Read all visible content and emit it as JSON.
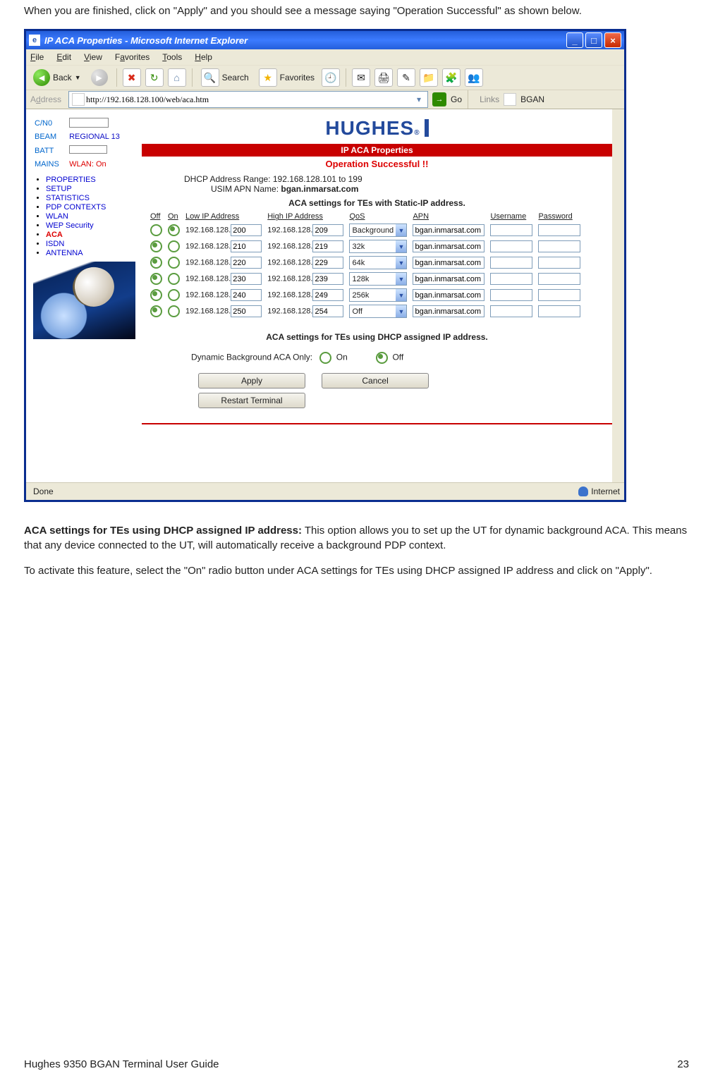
{
  "doc": {
    "intro_text": "When you are finished, click on \"Apply\" and you should see a message saying \"Operation Successful\" as shown below.",
    "after_title": "ACA settings for TEs using DHCP assigned IP address:",
    "after_body1": "  This option allows you to set up the UT for dynamic background ACA.  This means that any device connected to the UT, will automatically receive a background PDP context.",
    "after_body2": "To activate this feature, select the \"On\" radio button under ACA settings for TEs using DHCP assigned IP address and click on \"Apply\".",
    "footer_left": "Hughes 9350 BGAN Terminal User Guide",
    "footer_right": "23"
  },
  "window": {
    "title": "IP ACA Properties - Microsoft Internet Explorer",
    "menu": {
      "file": "File",
      "edit": "Edit",
      "view": "View",
      "favorites": "Favorites",
      "tools": "Tools",
      "help": "Help"
    },
    "toolbar": {
      "back": "Back",
      "search": "Search",
      "favorites": "Favorites"
    },
    "address_label": "Address",
    "url": "http://192.168.128.100/web/aca.htm",
    "go": "Go",
    "links_label": "Links",
    "link1": "BGAN",
    "status_left": "Done",
    "status_right": "Internet"
  },
  "sidebar": {
    "cn0": "C/N0",
    "beam_label": "BEAM",
    "beam_value": "REGIONAL 13",
    "batt": "BATT",
    "mains": "MAINS",
    "wlan": "WLAN: On",
    "nav": [
      "PROPERTIES",
      "SETUP",
      "STATISTICS",
      "PDP CONTEXTS",
      "WLAN",
      "WEP Security",
      "ACA",
      "ISDN",
      "ANTENNA"
    ],
    "active_index": 6
  },
  "page": {
    "logo": "HUGHES",
    "red_band": "IP ACA Properties",
    "success": "Operation Successful !!",
    "dhcp_range_label": "DHCP Address Range: ",
    "dhcp_range_value": "192.168.128.101 to 199",
    "apn_label": "USIM APN Name: ",
    "apn_value": "bgan.inmarsat.com",
    "sect1": "ACA settings for TEs with Static-IP address.",
    "headers": {
      "off": "Off",
      "on": "On",
      "low": "Low IP Address",
      "high": "High IP Address",
      "qos": "QoS",
      "apn": "APN",
      "user": "Username",
      "pass": "Password"
    },
    "ip_prefix": "192.168.128.",
    "rows": [
      {
        "off": false,
        "on": true,
        "low": "200",
        "high": "209",
        "qos": "Background",
        "apn": "bgan.inmarsat.com",
        "user": "",
        "pass": ""
      },
      {
        "off": true,
        "on": false,
        "low": "210",
        "high": "219",
        "qos": "32k",
        "apn": "bgan.inmarsat.com",
        "user": "",
        "pass": ""
      },
      {
        "off": true,
        "on": false,
        "low": "220",
        "high": "229",
        "qos": "64k",
        "apn": "bgan.inmarsat.com",
        "user": "",
        "pass": ""
      },
      {
        "off": true,
        "on": false,
        "low": "230",
        "high": "239",
        "qos": "128k",
        "apn": "bgan.inmarsat.com",
        "user": "",
        "pass": ""
      },
      {
        "off": true,
        "on": false,
        "low": "240",
        "high": "249",
        "qos": "256k",
        "apn": "bgan.inmarsat.com",
        "user": "",
        "pass": ""
      },
      {
        "off": true,
        "on": false,
        "low": "250",
        "high": "254",
        "qos": "Off",
        "apn": "bgan.inmarsat.com",
        "user": "",
        "pass": ""
      }
    ],
    "sect2": "ACA settings for TEs using DHCP assigned IP address.",
    "dyn_label": "Dynamic Background ACA Only:",
    "dyn_on": "On",
    "dyn_off": "Off",
    "dyn_selected": "off",
    "apply": "Apply",
    "cancel": "Cancel",
    "restart": "Restart Terminal"
  }
}
